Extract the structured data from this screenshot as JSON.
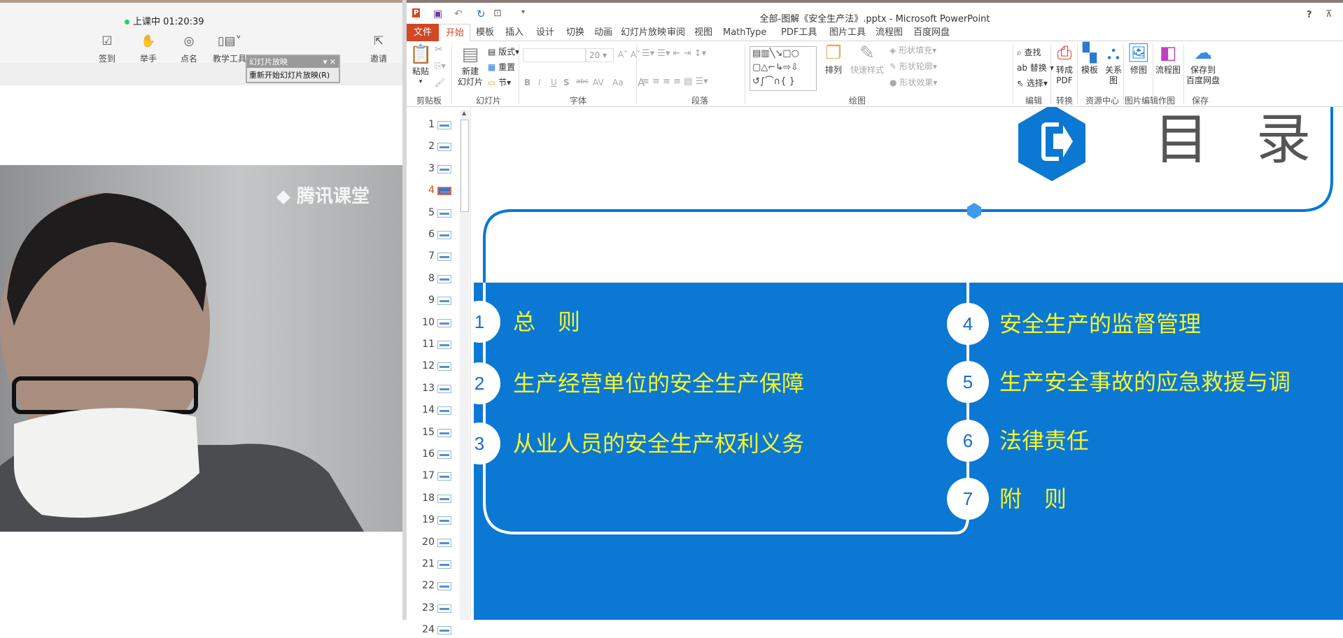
{
  "classroom": {
    "status": "上课中 01:20:39",
    "toolbar": [
      {
        "label": "签到",
        "icon": "checkin-icon"
      },
      {
        "label": "举手",
        "icon": "raise-hand-icon"
      },
      {
        "label": "点名",
        "icon": "roll-call-icon"
      },
      {
        "label": "教学工具",
        "icon": "teaching-tools-icon"
      },
      {
        "label": "邀请",
        "icon": "invite-icon"
      }
    ],
    "popup": {
      "title": "幻灯片放映",
      "item": "重新开始幻灯片放映(R)"
    },
    "watermark": "腾讯课堂"
  },
  "ppt": {
    "title": "全部-图解《安全生产法》.pptx - Microsoft PowerPoint",
    "help": "?",
    "tabs": [
      "文件",
      "开始",
      "模板",
      "插入",
      "设计",
      "切换",
      "动画",
      "幻灯片放映",
      "审阅",
      "视图",
      "MathType",
      "PDF工具",
      "图片工具",
      "流程图",
      "百度网盘"
    ],
    "active_tab": "开始",
    "ribbon": {
      "paste": "粘贴",
      "new_slide_1": "新建",
      "new_slide_2": "幻灯片",
      "layout": "版式",
      "reset": "重置",
      "section": "节",
      "font_size": "20",
      "bold": "B",
      "italic": "I",
      "underline": "U",
      "shadow": "S",
      "strike": "abc",
      "spacing": "AV",
      "case": "Aa",
      "font_color": "A",
      "arrange": "排列",
      "quick_styles": "快速样式",
      "shape_fill": "形状填充",
      "shape_outline": "形状轮廓",
      "shape_effects": "形状效果",
      "find": "查找",
      "replace": "替换",
      "select": "选择",
      "to_pdf_1": "转成",
      "to_pdf_2": "PDF",
      "template": "模板",
      "relation": "关系图",
      "retouch": "修图",
      "flowchart": "流程图",
      "save_baidu_1": "保存到",
      "save_baidu_2": "百度网盘",
      "groups": [
        "剪贴板",
        "幻灯片",
        "字体",
        "段落",
        "绘图",
        "编辑",
        "转换",
        "资源中心",
        "图片编辑",
        "作图",
        "保存"
      ]
    },
    "slides": [
      "1",
      "2",
      "3",
      "4",
      "5",
      "6",
      "7",
      "8",
      "9",
      "10",
      "11",
      "12",
      "13",
      "14",
      "15",
      "16",
      "17",
      "18",
      "19",
      "20",
      "21",
      "22",
      "23",
      "24"
    ],
    "selected_slide": "4"
  },
  "slide": {
    "title_1": "目",
    "title_2": "录",
    "items_left": [
      {
        "num": "1",
        "text": "总　则"
      },
      {
        "num": "2",
        "text": "生产经营单位的安全生产保障"
      },
      {
        "num": "3",
        "text": "从业人员的安全生产权利义务"
      }
    ],
    "items_right": [
      {
        "num": "4",
        "text": "安全生产的监督管理"
      },
      {
        "num": "5",
        "text": "生产安全事故的应急救援与调"
      },
      {
        "num": "6",
        "text": "法律责任"
      },
      {
        "num": "7",
        "text": "附　则"
      }
    ],
    "colors": {
      "blue": "#0b78d4",
      "yellow": "#f7f52a",
      "grey_text": "#555555"
    }
  }
}
